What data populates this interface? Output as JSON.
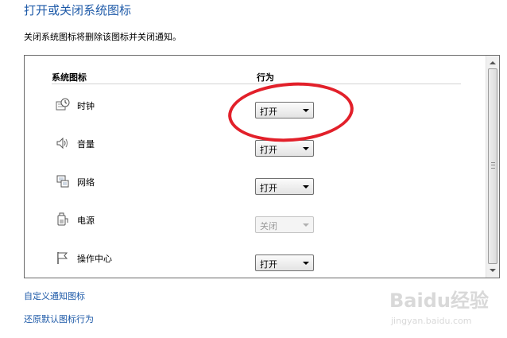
{
  "page": {
    "title": "打开或关闭系统图标",
    "description": "关闭系统图标将删除该图标并关闭通知。"
  },
  "table": {
    "col_icon": "系统图标",
    "col_action": "行为",
    "rows": [
      {
        "icon": "clock-icon",
        "label": "时钟",
        "action": "打开",
        "enabled": true
      },
      {
        "icon": "volume-icon",
        "label": "音量",
        "action": "打开",
        "enabled": true
      },
      {
        "icon": "network-icon",
        "label": "网络",
        "action": "打开",
        "enabled": true
      },
      {
        "icon": "power-icon",
        "label": "电源",
        "action": "关闭",
        "enabled": false
      },
      {
        "icon": "action-center-flag-icon",
        "label": "操作中心",
        "action": "打开",
        "enabled": true
      }
    ]
  },
  "links": {
    "customize": "自定义通知图标",
    "restore": "还原默认图标行为"
  },
  "watermark": {
    "text": "Baidu经验",
    "url": "jingyan.baidu.com"
  },
  "colors": {
    "link": "#1e5aa8",
    "annotation": "#e2202a"
  }
}
